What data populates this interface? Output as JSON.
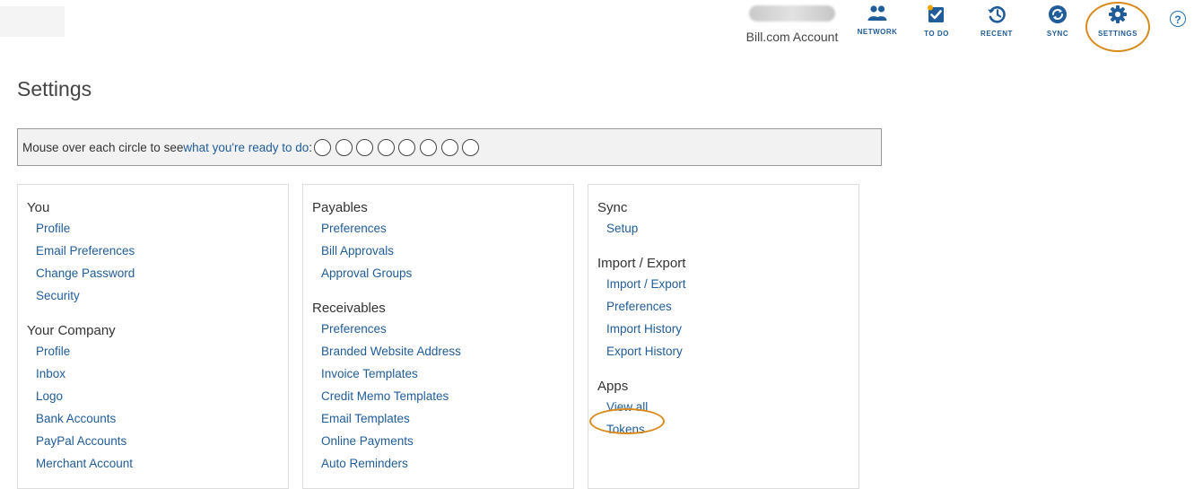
{
  "header": {
    "account_name_hidden": "",
    "account_label": "Bill.com Account",
    "nav": [
      {
        "label": "NETWORK",
        "icon": "people-icon"
      },
      {
        "label": "TO DO",
        "icon": "checkbox-icon"
      },
      {
        "label": "RECENT",
        "icon": "history-icon"
      },
      {
        "label": "SYNC",
        "icon": "sync-icon"
      },
      {
        "label": "SETTINGS",
        "icon": "gear-icon"
      }
    ],
    "help_symbol": "?"
  },
  "page_title": "Settings",
  "ready_bar": {
    "prefix": "Mouse over each circle to see ",
    "link": "what you're ready to do",
    "suffix": ":",
    "circle_count": 8
  },
  "columns": [
    {
      "sections": [
        {
          "title": "You",
          "links": [
            "Profile",
            "Email Preferences",
            "Change Password",
            "Security"
          ]
        },
        {
          "title": "Your Company",
          "links": [
            "Profile",
            "Inbox",
            "Logo",
            "Bank Accounts",
            "PayPal Accounts",
            "Merchant Account"
          ]
        }
      ]
    },
    {
      "sections": [
        {
          "title": "Payables",
          "links": [
            "Preferences",
            "Bill Approvals",
            "Approval Groups"
          ]
        },
        {
          "title": "Receivables",
          "links": [
            "Preferences",
            "Branded Website Address",
            "Invoice Templates",
            "Credit Memo Templates",
            "Email Templates",
            "Online Payments",
            "Auto Reminders"
          ]
        }
      ]
    },
    {
      "sections": [
        {
          "title": "Sync",
          "links": [
            "Setup"
          ]
        },
        {
          "title": "Import / Export",
          "links": [
            "Import / Export",
            "Preferences",
            "Import History",
            "Export History"
          ]
        },
        {
          "title": "Apps",
          "links": [
            "View all",
            "Tokens"
          ]
        }
      ]
    }
  ],
  "colors": {
    "link": "#1f5c99",
    "annotation": "#d98a1b",
    "todo_badge": "#f0a500"
  }
}
